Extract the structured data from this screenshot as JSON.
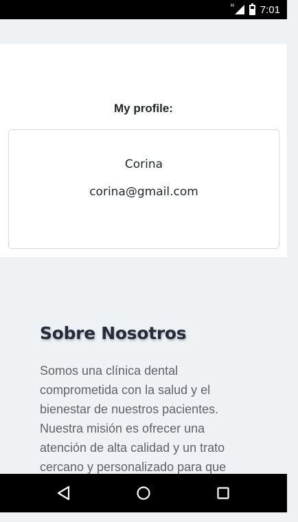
{
  "status_bar": {
    "network_label": "H",
    "time": "7:01",
    "icons": [
      "signal-icon",
      "battery-charging-icon"
    ]
  },
  "profile": {
    "heading": "My profile:",
    "name": "Corina",
    "email": "corina@gmail.com"
  },
  "about": {
    "title": "Sobre Nosotros",
    "body": "Somos una clínica dental comprometida con la salud y el bienestar de nuestros pacientes. Nuestra misión es ofrecer una atención de alta calidad y un trato cercano y personalizado para que"
  },
  "navigation": {
    "buttons": [
      "back-icon",
      "home-icon",
      "recents-icon"
    ]
  },
  "colors": {
    "page_background": "#eef2f5",
    "card_background": "#ffffff",
    "card_border": "#d6d9dc",
    "heading_text": "#262a3b",
    "body_text": "#5f6368",
    "system_bars": "#000000"
  }
}
